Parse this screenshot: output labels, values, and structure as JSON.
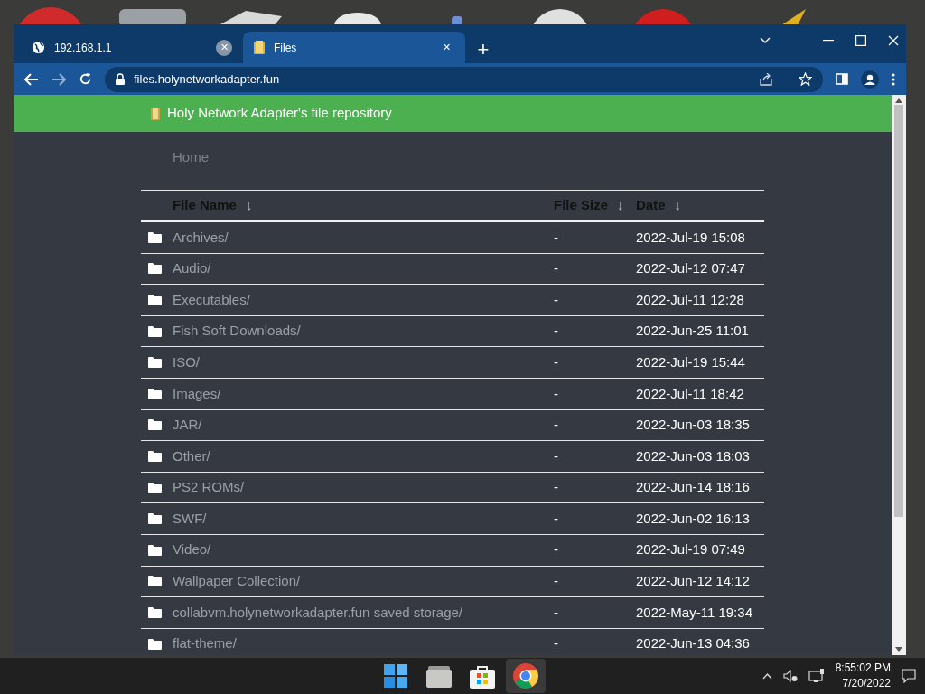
{
  "tabs": [
    {
      "title": "192.168.1.1",
      "selected": false,
      "close": "✕"
    },
    {
      "title": "Files",
      "selected": true,
      "close": "✕"
    }
  ],
  "new_tab": "+",
  "address": "files.holynetworkadapter.fun",
  "site_title": "Holy Network Adapter's file repository",
  "breadcrumb": "Home",
  "table": {
    "columns": [
      {
        "label": "File Name",
        "sort": "↓"
      },
      {
        "label": "File Size",
        "sort": "↓"
      },
      {
        "label": "Date",
        "sort": "↓"
      }
    ],
    "rows": [
      {
        "name": "Archives/",
        "size": "-",
        "date": "2022-Jul-19 15:08"
      },
      {
        "name": "Audio/",
        "size": "-",
        "date": "2022-Jul-12 07:47"
      },
      {
        "name": "Executables/",
        "size": "-",
        "date": "2022-Jul-11 12:28"
      },
      {
        "name": "Fish Soft Downloads/",
        "size": "-",
        "date": "2022-Jun-25 11:01"
      },
      {
        "name": "ISO/",
        "size": "-",
        "date": "2022-Jul-19 15:44"
      },
      {
        "name": "Images/",
        "size": "-",
        "date": "2022-Jul-11 18:42"
      },
      {
        "name": "JAR/",
        "size": "-",
        "date": "2022-Jun-03 18:35"
      },
      {
        "name": "Other/",
        "size": "-",
        "date": "2022-Jun-03 18:03"
      },
      {
        "name": "PS2 ROMs/",
        "size": "-",
        "date": "2022-Jun-14 18:16"
      },
      {
        "name": "SWF/",
        "size": "-",
        "date": "2022-Jun-02 16:13"
      },
      {
        "name": "Video/",
        "size": "-",
        "date": "2022-Jul-19 07:49"
      },
      {
        "name": "Wallpaper Collection/",
        "size": "-",
        "date": "2022-Jun-12 14:12"
      },
      {
        "name": "collabvm.holynetworkadapter.fun saved storage/",
        "size": "-",
        "date": "2022-May-11 19:34"
      },
      {
        "name": "flat-theme/",
        "size": "-",
        "date": "2022-Jun-13 04:36"
      }
    ]
  },
  "taskbar": {
    "apps": [
      {
        "kind": "start",
        "selected": false
      },
      {
        "kind": "files",
        "selected": false
      },
      {
        "kind": "store",
        "selected": false
      },
      {
        "kind": "chrome",
        "selected": true
      }
    ],
    "time": "8:55:02 PM",
    "date": "7/20/2022"
  }
}
